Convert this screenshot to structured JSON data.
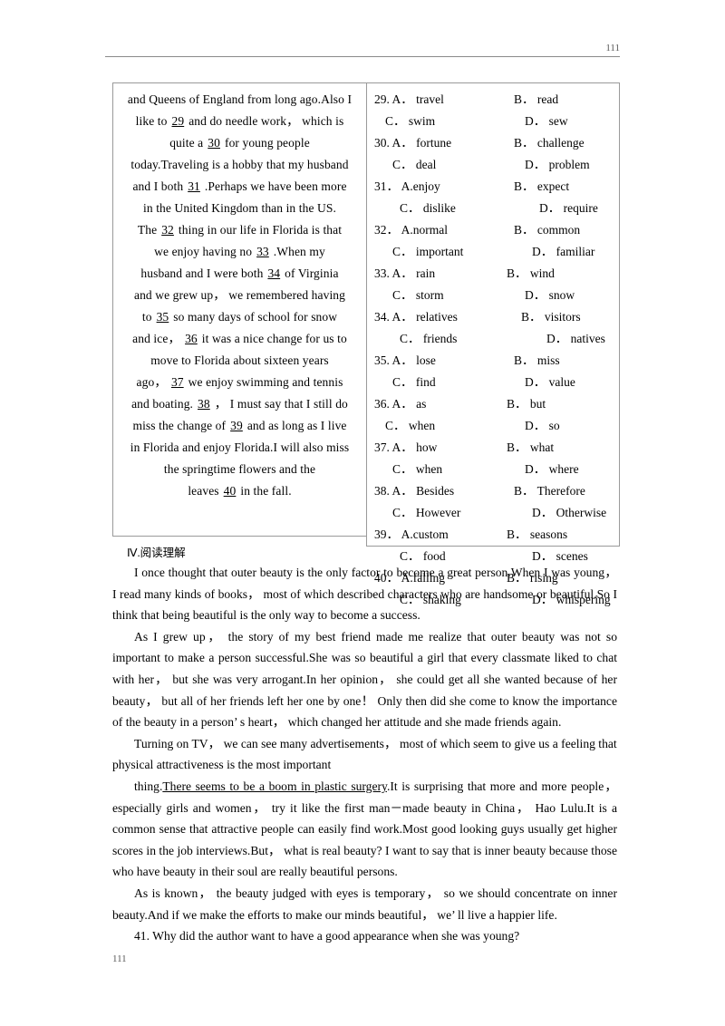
{
  "header": {
    "page_number": "111"
  },
  "footer": {
    "page_number": "111"
  },
  "cloze": {
    "passage_lines": [
      {
        "align": "ctr",
        "text": "and Queens of England from long ago.Also I"
      },
      {
        "align": "ctr",
        "pre": "like to",
        "blank": "29",
        "post": "and do needle work， which is"
      },
      {
        "align": "ctr",
        "pre": "quite a",
        "blank": "30",
        "post": "for young people"
      },
      {
        "align": "ctr",
        "text": "today.Traveling is a hobby that my husband"
      },
      {
        "align": "ctr",
        "pre": "and I both",
        "blank": "31",
        "post": ".Perhaps we have been more"
      },
      {
        "align": "ctr",
        "text": "in the United Kingdom than in the US."
      },
      {
        "align": "ctr",
        "pre": "The",
        "blank": "32",
        "post": "thing in our life in Florida is that"
      },
      {
        "align": "ctr",
        "pre": "we enjoy having no",
        "blank": "33",
        "post": ".When my"
      },
      {
        "align": "ctr",
        "pre": "husband and I were both",
        "blank": "34",
        "post": "of Virginia"
      },
      {
        "align": "ctr",
        "text": "and we grew up， we remembered having"
      },
      {
        "align": "ctr",
        "pre": "to",
        "blank": "35",
        "post": "so many days of school for snow"
      },
      {
        "align": "ctr",
        "pre": "and ice，",
        "blank": "36",
        "post": "it was a nice change for us to"
      },
      {
        "align": "ctr",
        "text": "move to Florida about sixteen years"
      },
      {
        "align": "ctr",
        "pre": "ago，",
        "blank": "37",
        "post": "we enjoy swimming and tennis"
      },
      {
        "align": "ctr",
        "pre": "and boating.",
        "blank": "38",
        "post": "， I must say that I still do"
      },
      {
        "align": "ctr",
        "pre": "miss the change of",
        "blank": "39",
        "post": "and as long as I live"
      },
      {
        "align": "ctr",
        "text": "in Florida and enjoy Florida.I will also miss"
      },
      {
        "align": "ctr",
        "text": "the springtime flowers and the"
      },
      {
        "align": "ctr",
        "pre": "leaves",
        "blank": "40",
        "post": "in the fall."
      }
    ],
    "option_rows": [
      {
        "a": "29. A． travel",
        "b": "B． read",
        "a_indent": 0,
        "b_indent": 1
      },
      {
        "a": "C． swim",
        "b": "D． sew",
        "a_indent": 1,
        "b_indent": 1
      },
      {
        "a": "30. A． fortune",
        "b": "B． challenge",
        "a_indent": 0,
        "b_indent": 1
      },
      {
        "a": "C． deal",
        "b": "D． problem",
        "a_indent": 2,
        "b_indent": 0
      },
      {
        "a": "31． A.enjoy",
        "b": "B． expect",
        "a_indent": 0,
        "b_indent": 1
      },
      {
        "a": "C． dislike",
        "b": "D． require",
        "a_indent": 3,
        "b_indent": 1
      },
      {
        "a": "32． A.normal",
        "b": "B． common",
        "a_indent": 0,
        "b_indent": 1
      },
      {
        "a": "C． important",
        "b": "D． familiar",
        "a_indent": 2,
        "b_indent": 1
      },
      {
        "a": "33. A． rain",
        "b": "B． wind",
        "a_indent": 0,
        "b_indent": 0
      },
      {
        "a": "C． storm",
        "b": "D． snow",
        "a_indent": 2,
        "b_indent": 0
      },
      {
        "a": "34. A． relatives",
        "b": "B． visitors",
        "a_indent": 0,
        "b_indent": 2
      },
      {
        "a": "C． friends",
        "b": "D． natives",
        "a_indent": 3,
        "b_indent": 2
      },
      {
        "a": "35. A． lose",
        "b": "B． miss",
        "a_indent": 0,
        "b_indent": 1
      },
      {
        "a": "C． find",
        "b": "D． value",
        "a_indent": 2,
        "b_indent": 0
      },
      {
        "a": "36. A． as",
        "b": "B． but",
        "a_indent": 0,
        "b_indent": 0
      },
      {
        "a": "C． when",
        "b": "D． so",
        "a_indent": 1,
        "b_indent": 1
      },
      {
        "a": "37. A． how",
        "b": "B． what",
        "a_indent": 0,
        "b_indent": 0
      },
      {
        "a": "C． when",
        "b": "D． where",
        "a_indent": 2,
        "b_indent": 0
      },
      {
        "a": "38. A． Besides",
        "b": "B． Therefore",
        "a_indent": 0,
        "b_indent": 1
      },
      {
        "a": "C． However",
        "b": "D． Otherwise",
        "a_indent": 2,
        "b_indent": 1
      },
      {
        "a": "39． A.custom",
        "b": "B． seasons",
        "a_indent": 0,
        "b_indent": 0
      },
      {
        "a": "C． food",
        "b": "D． scenes",
        "a_indent": 3,
        "b_indent": 0
      },
      {
        "a": "40． A.falling",
        "b": "B． rising",
        "a_indent": 0,
        "b_indent": 0
      },
      {
        "a": "C． shaking",
        "b": "D． whispering",
        "a_indent": 3,
        "b_indent": 0
      }
    ]
  },
  "reading": {
    "heading": "Ⅳ.阅读理解",
    "paragraph_1": "I once thought that outer beauty is the only factor to become a great person.When I was young， I read many kinds of books， most of which described characters who are handsome or beautiful.So I think that being beautiful is the only way to become a success.",
    "paragraph_2": "As I grew up， the story of my best friend made me realize that outer beauty was not so important to make a person successful.She was so beautiful a girl that every classmate liked to chat with her， but she was very arrogant.In her opinion， she could get all she wanted because of her beauty， but all of her friends left her one by one！ Only then did she come to know the importance of the beauty in a person’ s heart， which changed her attitude and she made friends again.",
    "paragraph_3": "Turning on TV， we can see many advertisements， most of which seem to give us a feeling that physical attractiveness is the most important",
    "paragraph_4_pre": "thing.",
    "paragraph_4_underlined": "There seems to be a boom in plastic surgery",
    "paragraph_4_post": ".It is surprising that more and more people， especially girls and women， try it like the first man－made beauty in China， Hao Lulu.It is a common sense that attractive people can easily find work.Most good looking guys usually get higher scores in the job interviews.But， what is real beauty? I want to say that is inner beauty because those who have beauty in their soul are really beautiful persons.",
    "paragraph_5": "As is known， the beauty judged with eyes is temporary， so we should concentrate on inner beauty.And if we make the efforts to make our minds beautiful， we’ ll live a happier life.",
    "question_41": "41. Why did the author want to have a good appearance when she was young?"
  }
}
